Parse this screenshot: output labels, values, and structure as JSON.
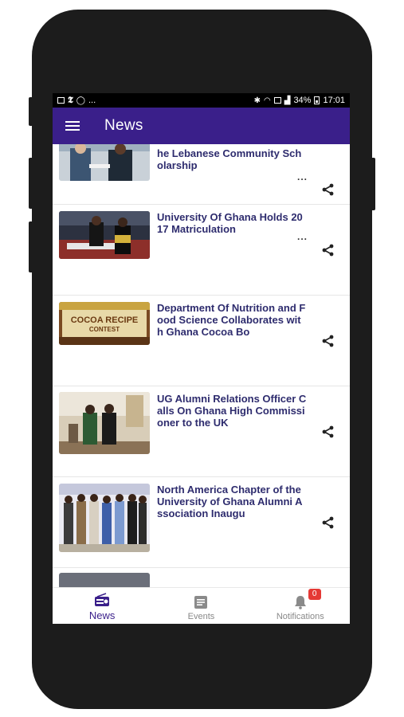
{
  "status_bar": {
    "left_more": "...",
    "battery": "34%",
    "time": "17:01"
  },
  "app_bar": {
    "title": "News"
  },
  "news": [
    {
      "title": "he Lebanese Community Scholarship",
      "more": "...",
      "thumb": "handshake-photo"
    },
    {
      "title": "University Of Ghana Holds 2017 Matriculation",
      "more": "...",
      "thumb": "matriculation-photo"
    },
    {
      "title": "Department Of Nutrition and Food Science Collaborates with Ghana Cocoa Bo",
      "more": "...",
      "thumb": "cocoa-recipe-contest-photo",
      "thumb_text_1": "COCOA RECIPE",
      "thumb_text_2": "CONTEST"
    },
    {
      "title": "UG Alumni Relations Officer Calls On Ghana High Commissioner to the UK",
      "more": "...",
      "thumb": "office-visit-photo"
    },
    {
      "title": "North America Chapter of the University of Ghana Alumni Association Inaugu",
      "more": "...",
      "thumb": "group-photo"
    }
  ],
  "bottom_nav": {
    "items": [
      {
        "label": "News",
        "icon": "radio-icon",
        "active": true
      },
      {
        "label": "Events",
        "icon": "list-icon",
        "active": false
      },
      {
        "label": "Notifications",
        "icon": "bell-icon",
        "active": false,
        "badge": "0"
      }
    ]
  },
  "colors": {
    "primary": "#3a1f8a",
    "title_text": "#2e2c6e",
    "badge": "#e53935"
  }
}
